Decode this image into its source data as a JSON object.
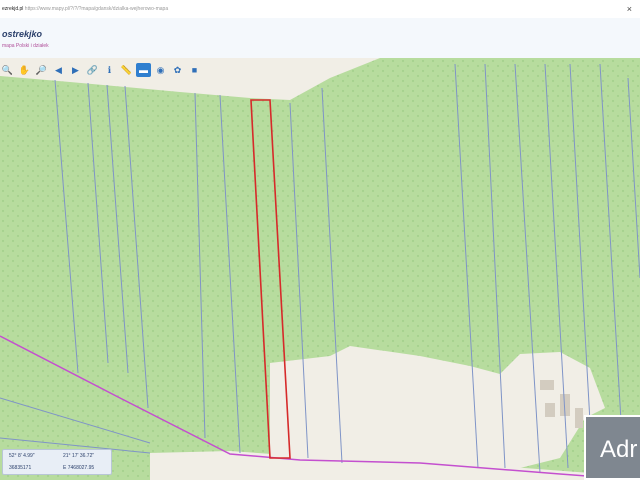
{
  "browser": {
    "host": "ezrekjd.pl",
    "url_path": " https://www.mapy.pl/?/?/?mapa/gdansk/dzialka-wejherowo-mapa",
    "close_label": "×"
  },
  "header": {
    "brand": "ostrekjko",
    "subtitle": "mapa Polski i działek"
  },
  "toolbar": {
    "tools": [
      {
        "name": "zoom-in-icon",
        "glyph": "🔍"
      },
      {
        "name": "pan-hand-icon",
        "glyph": "✋"
      },
      {
        "name": "zoom-out-icon",
        "glyph": "🔎"
      },
      {
        "name": "back-arrow-icon",
        "glyph": "◀"
      },
      {
        "name": "forward-arrow-icon",
        "glyph": "▶"
      },
      {
        "name": "link-icon",
        "glyph": "🔗"
      },
      {
        "name": "info-icon",
        "glyph": "ℹ"
      },
      {
        "name": "measure-icon",
        "glyph": "📏"
      },
      {
        "name": "layers-icon",
        "glyph": "▬"
      },
      {
        "name": "globe-icon",
        "glyph": "◉"
      },
      {
        "name": "settings-icon",
        "glyph": "✿"
      },
      {
        "name": "camera-icon",
        "glyph": "■"
      }
    ],
    "active_index": 8,
    "accent_color": "#2f7fcf"
  },
  "map": {
    "colors": {
      "forest": "#b7dc9e",
      "bare": "#f1eee6",
      "parcel_line": "#7f94c7",
      "selected_parcel": "#d62a2a",
      "road": "#c44fcf"
    }
  },
  "coords": {
    "row1_a": "52° 8' 4.99\"",
    "row1_b": "21° 17' 36.72\"",
    "row2_a": "36835171",
    "row2_b": "E 7468027.95"
  },
  "ad": {
    "label": "Adr"
  }
}
